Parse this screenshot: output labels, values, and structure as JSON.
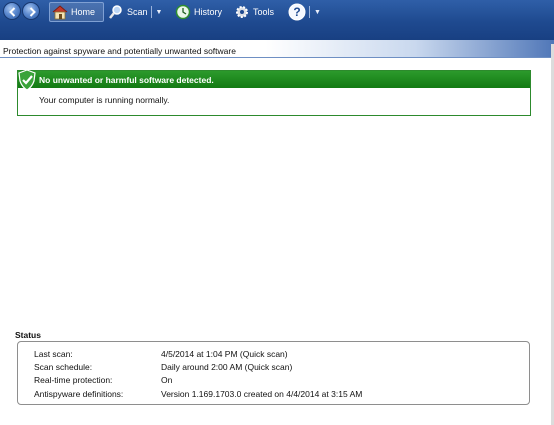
{
  "toolbar": {
    "home_label": "Home",
    "scan_label": "Scan",
    "history_label": "History",
    "tools_label": "Tools",
    "help_label": "?",
    "icons": [
      "back-arrow-icon",
      "forward-arrow-icon",
      "home-icon",
      "magnifier-icon",
      "history-clock-icon",
      "gear-icon",
      "help-icon"
    ]
  },
  "header": {
    "subtitle": "Protection against spyware and potentially unwanted software"
  },
  "alert": {
    "title": "No unwanted or harmful software detected.",
    "message": "Your computer is running normally.",
    "color": "#1c8a1c"
  },
  "status": {
    "title": "Status",
    "rows": [
      {
        "label": "Last scan:",
        "value": "4/5/2014 at 1:04 PM (Quick scan)"
      },
      {
        "label": "Scan schedule:",
        "value": "Daily around 2:00 AM (Quick scan)"
      },
      {
        "label": "Real-time protection:",
        "value": "On"
      },
      {
        "label": "Antispyware definitions:",
        "value": "Version 1.169.1703.0 created on 4/4/2014 at 3:15 AM"
      }
    ]
  }
}
